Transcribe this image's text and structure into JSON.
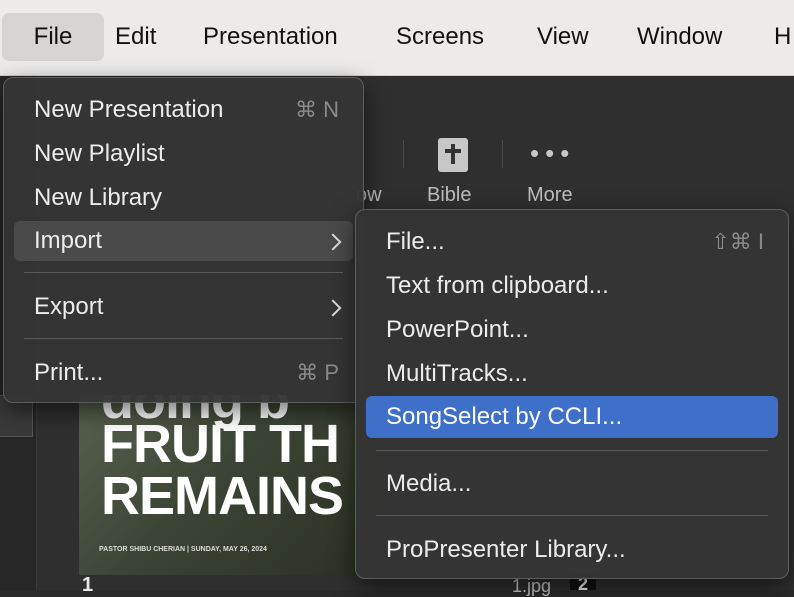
{
  "menubar": {
    "items": [
      "File",
      "Edit",
      "Presentation",
      "Screens",
      "View",
      "Window",
      "H"
    ]
  },
  "toolbar": {
    "partial_label": "ow",
    "bible_label": "Bible",
    "more_label": "More"
  },
  "file_menu": {
    "items": [
      {
        "label": "New Presentation",
        "shortcut": "⌘ N"
      },
      {
        "label": "New Playlist",
        "shortcut": ""
      },
      {
        "label": "New Library",
        "shortcut": ""
      },
      {
        "label": "Import",
        "shortcut": "",
        "submenu": true
      },
      {
        "label": "Export",
        "shortcut": "",
        "submenu": true
      },
      {
        "label": "Print...",
        "shortcut": "⌘ P"
      }
    ]
  },
  "import_menu": {
    "items": [
      {
        "label": "File...",
        "shortcut": "⇧⌘ I"
      },
      {
        "label": "Text from clipboard...",
        "shortcut": ""
      },
      {
        "label": "PowerPoint...",
        "shortcut": ""
      },
      {
        "label": "MultiTracks...",
        "shortcut": ""
      },
      {
        "label": "SongSelect by CCLI...",
        "shortcut": ""
      },
      {
        "label": "Media...",
        "shortcut": ""
      },
      {
        "label": "ProPresenter Library...",
        "shortcut": ""
      }
    ]
  },
  "slide": {
    "line1": "doing b",
    "line2": "FRUIT TH",
    "line3": "REMAINS",
    "caption": "PASTOR SHIBU CHERIAN | SUNDAY, MAY 26, 2024",
    "number1": "1",
    "file_label": "1.jpg",
    "number2": "2"
  },
  "colors": {
    "selection": "#3e6fc9",
    "menu_bg": "#343434",
    "menubar_bg": "#ecebea"
  }
}
